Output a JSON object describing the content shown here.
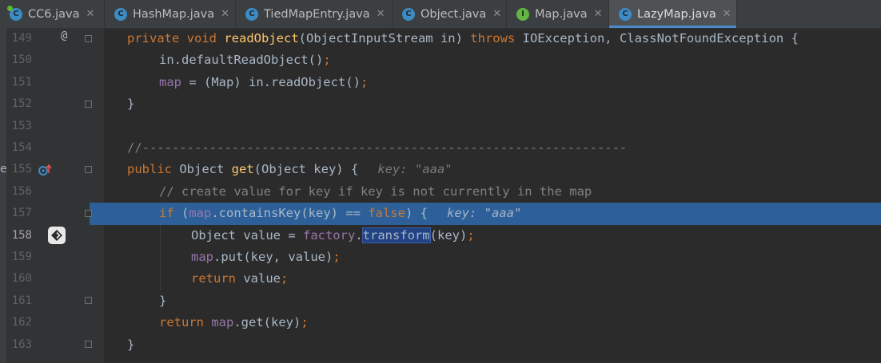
{
  "tabs": [
    {
      "label": "CC6.java",
      "icon": "run-class-icon",
      "active": false
    },
    {
      "label": "HashMap.java",
      "icon": "class-icon",
      "active": false
    },
    {
      "label": "TiedMapEntry.java",
      "icon": "class-icon",
      "active": false
    },
    {
      "label": "Object.java",
      "icon": "class-icon",
      "active": false
    },
    {
      "label": "Map.java",
      "icon": "interface-icon",
      "active": false
    },
    {
      "label": "LazyMap.java",
      "icon": "class-icon",
      "active": true
    }
  ],
  "close_glyph": "✕",
  "icon_letters": {
    "class": "C",
    "interface": "I"
  },
  "gutter_marks": {
    "override": "@",
    "partial_line_char": "e"
  },
  "line_numbers": [
    "149",
    "150",
    "151",
    "152",
    "153",
    "154",
    "155",
    "156",
    "157",
    "158",
    "159",
    "160",
    "161",
    "162",
    "163"
  ],
  "code": {
    "l149": {
      "kw1": "private void ",
      "fn": "readObject",
      "p1": "(ObjectInputStream in) ",
      "kw2": "throws ",
      "p2": "IOException, ClassNotFoundException {"
    },
    "l150": {
      "t": "in.defaultReadObject()",
      "semi": ";"
    },
    "l151": {
      "f": "map",
      "t": " = (Map) in.readObject()",
      "semi": ";"
    },
    "l152": {
      "t": "}"
    },
    "l154": {
      "t": "//-----------------------------------------------------------------"
    },
    "l155": {
      "kw": "public ",
      "t1": "Object ",
      "fn": "get",
      "t2": "(Object key) {",
      "hint": "key: \"aaa\""
    },
    "l156": {
      "t": "// create value for key if key is not currently in the map"
    },
    "l157": {
      "kw": "if ",
      "t1": "(",
      "f": "map",
      "t2": ".containsKey(key) == ",
      "kw2": "false",
      "t3": ") {",
      "hint": "key: \"aaa\""
    },
    "l158": {
      "t1": "Object value = ",
      "f": "factory",
      "t2": ".",
      "sel": "transform",
      "t3": "(key)",
      "semi": ";"
    },
    "l159": {
      "f": "map",
      "t": ".put(key, value)",
      "semi": ";"
    },
    "l160": {
      "kw": "return ",
      "t": "value",
      "semi": ";"
    },
    "l161": {
      "t": "}"
    },
    "l162": {
      "kw": "return ",
      "f": "map",
      "t": ".get(key)",
      "semi": ";"
    },
    "l163": {
      "t": "}"
    }
  },
  "colors": {
    "background": "#2b2b2b",
    "keyword": "#cc7832",
    "method": "#ffc66d",
    "field": "#9876aa",
    "comment": "#808080",
    "execution_line": "#2d6099"
  }
}
